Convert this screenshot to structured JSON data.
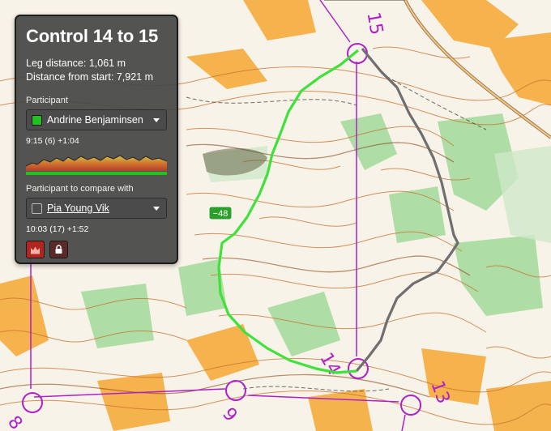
{
  "panel": {
    "title": "Control 14 to 15",
    "leg_distance": "Leg distance: 1,061 m",
    "distance_from_start": "Distance from start: 7,921 m",
    "participant_label": "Participant",
    "participant": {
      "name": "Andrine Benjaminsen",
      "color": "#1fc21f"
    },
    "participant_time": "9:15 (6) +1:04",
    "compare_label": "Participant to compare with",
    "compare": {
      "name": "Pia Young Vik",
      "color": "#4b4b4b"
    },
    "compare_time": "10:03 (17) +1:52",
    "buttons": [
      {
        "icon": "crown-icon",
        "color": "#b0261f"
      },
      {
        "icon": "lock-icon",
        "color": "#5a2a28"
      }
    ]
  },
  "map": {
    "control_numbers": [
      "15",
      "14",
      "13",
      "9",
      "8"
    ],
    "time_diff_badge": "−48",
    "route_colors": {
      "participant": "#3ee23a",
      "compare": "#6f6f6f",
      "course": "#b020c8"
    }
  }
}
